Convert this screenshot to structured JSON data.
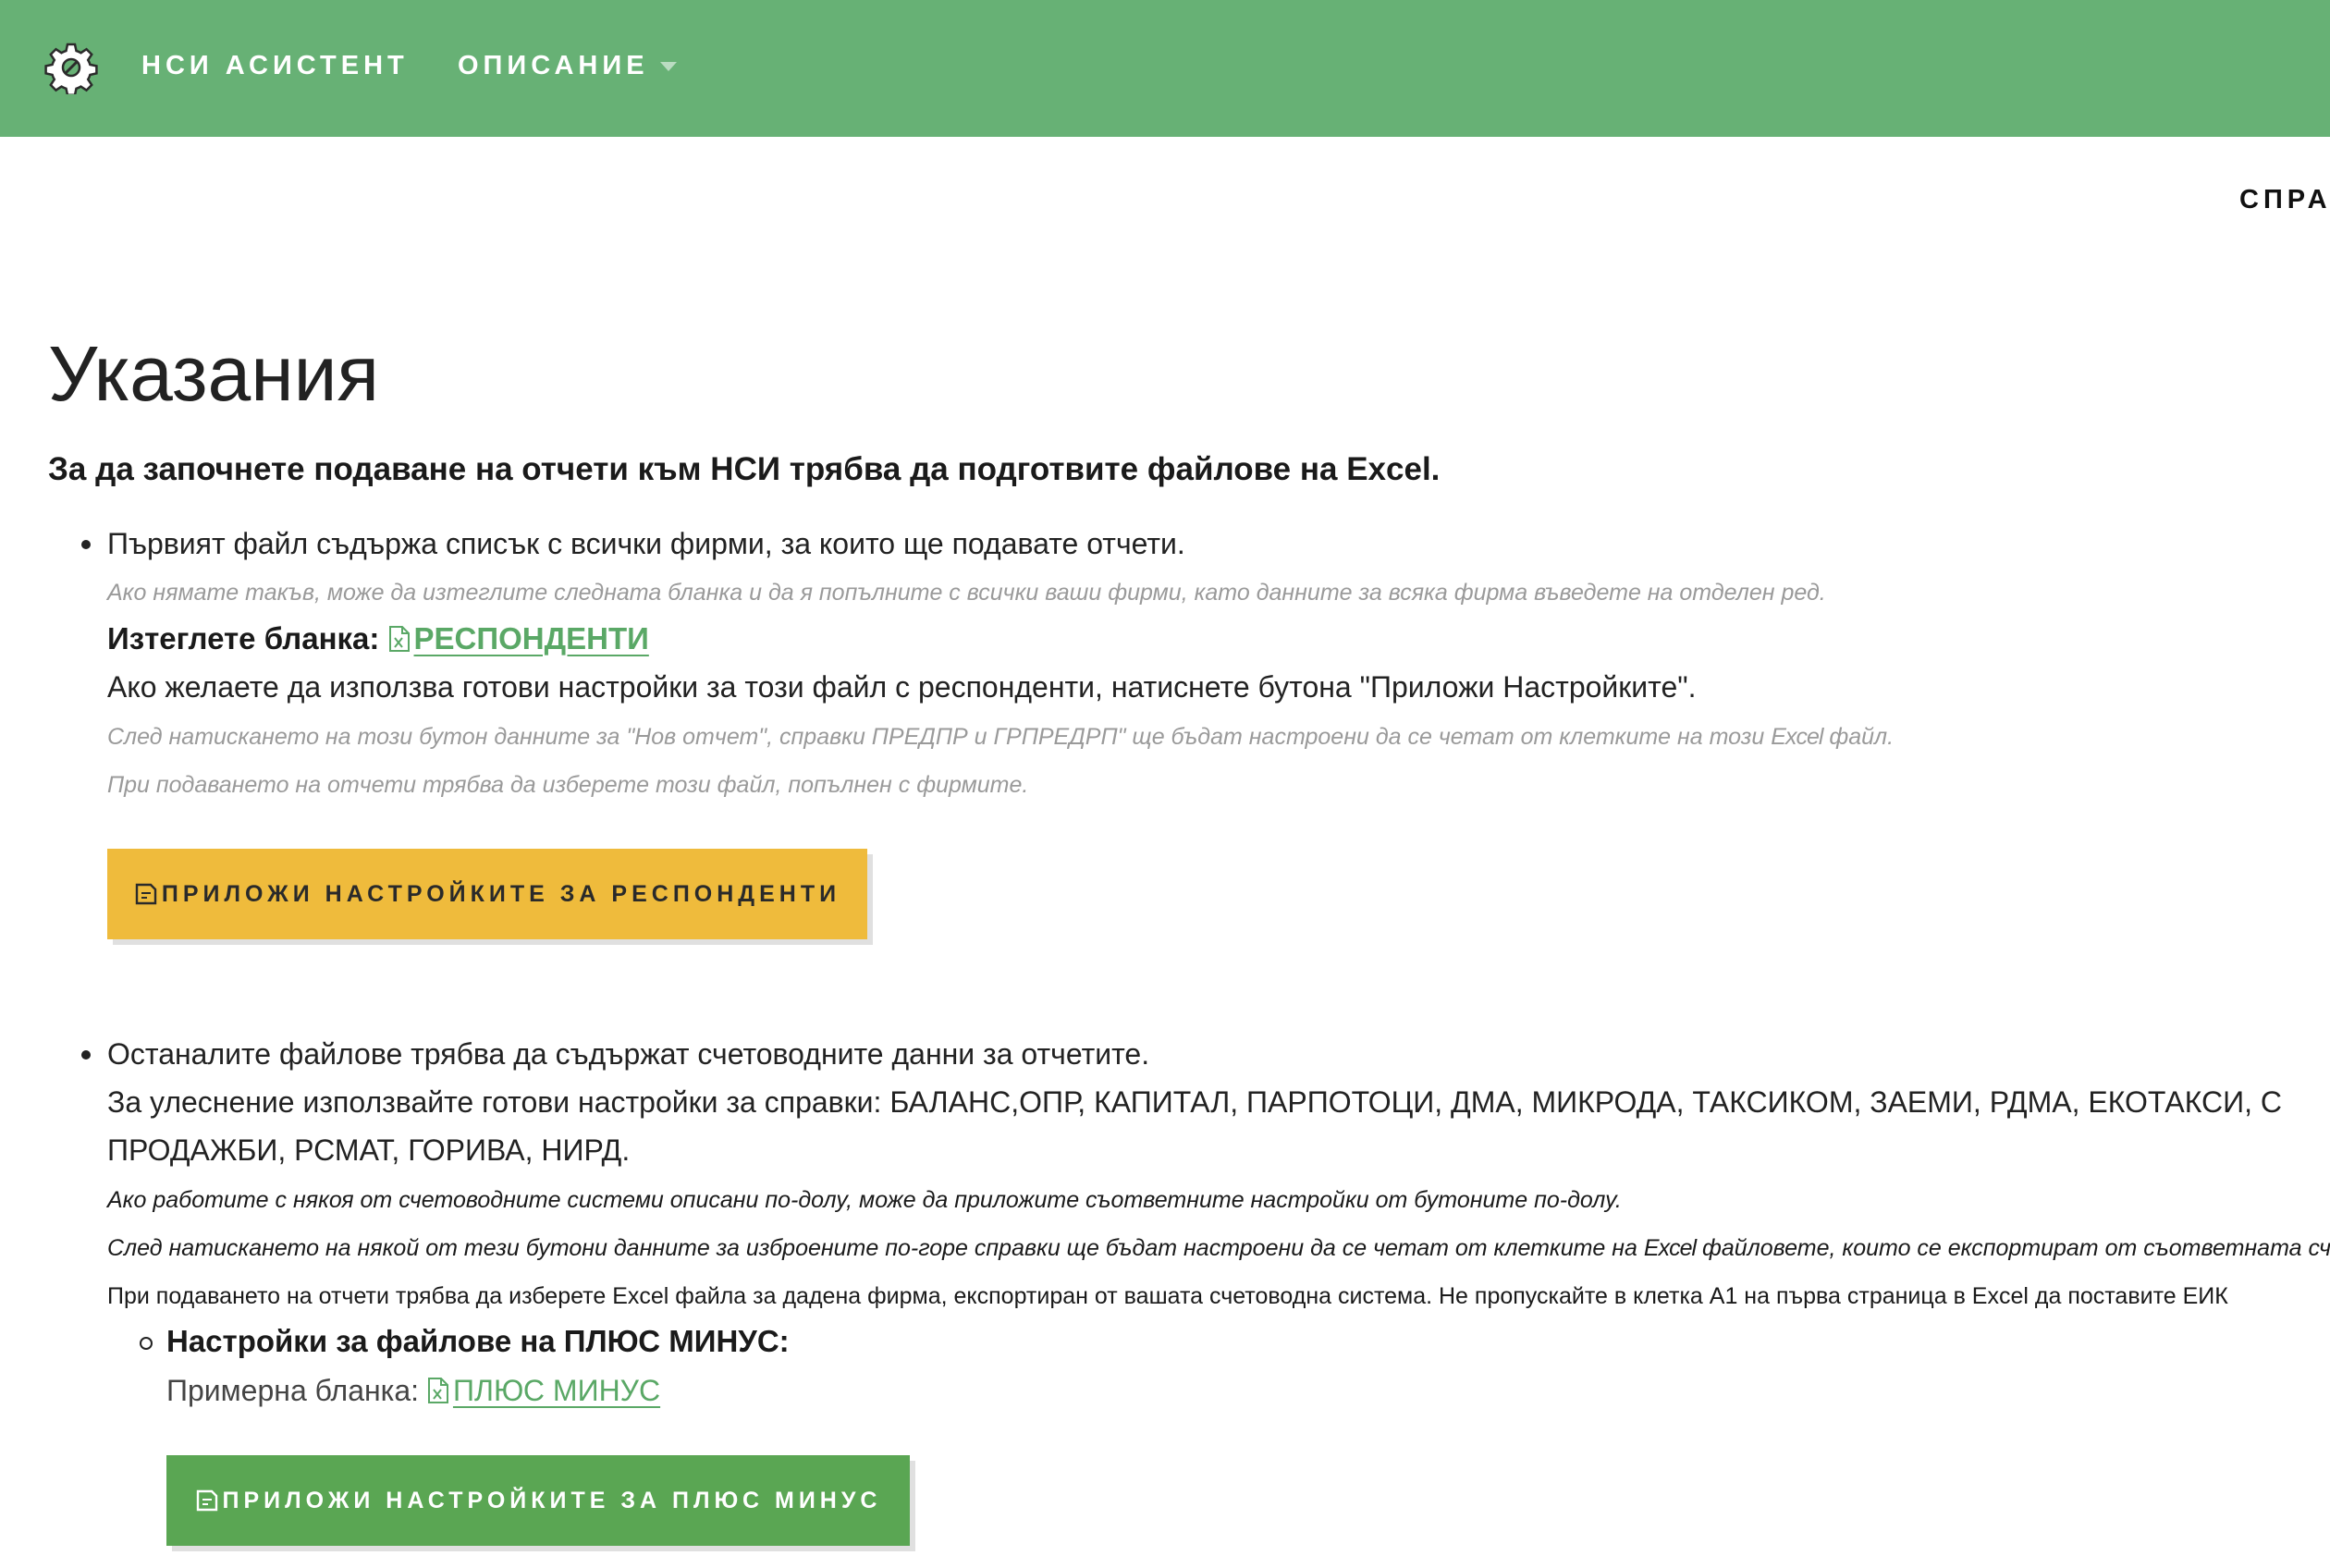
{
  "nav": {
    "brand": "НСИ АСИСТЕНТ",
    "description_menu": "ОПИСАНИЕ",
    "right_cut": "СПРА"
  },
  "page": {
    "title": "Указания",
    "lead": "За да започнете подаване на отчети към НСИ трябва да подготвите файлове на Excel."
  },
  "section1": {
    "bullet": "Първият файл съдържа списък с всички фирми, за които ще подавате отчети.",
    "note": "Ако нямате такъв, може да изтеглите следната бланка и да я попълните с всички ваши фирми, като данните за всяка фирма въведете на отделен ред.",
    "download_label": "Изтеглете бланка:",
    "download_link": "РЕСПОНДЕНТИ",
    "settings_text": "Ако желаете да използва готови настройки за този файл с респонденти, натиснете бутона \"Приложи Настройките\".",
    "note2_start": "След натискането на този бутон данните за \"Нов отчет\", справки ПРЕДПР и ГРПРЕДРП\" ще бъдат настроени да се четат от клетките на този ",
    "note2_excel": "Excel",
    "note2_end": " файл.",
    "note3": "При подаването на отчети трябва да изберете този файл, попълнен с фирмите.",
    "button": "ПРИЛОЖИ НАСТРОЙКИТЕ ЗА РЕСПОНДЕНТИ"
  },
  "section2": {
    "bullet": "Останалите файлове трябва да съдържат счетоводните данни за отчетите.",
    "reports_line1": "За улеснение използвайте готови настройки за справки: БАЛАНС,ОПР, КАПИТАЛ, ПАРПОТОЦИ, ДМА, МИКРОДА, ТАКСИКОМ, ЗАЕМИ, РДМА, ЕКОТАКСИ, С",
    "reports_line2": "ПРОДАЖБИ, РСМАТ, ГОРИВА, НИРД.",
    "note1": "Ако работите с някоя от счетоводните системи описани по-долу, може да приложите съответните настройки от бутоните по-долу.",
    "note2_start": "След натискането на някой от тези бутони данните за изброените по-горе справки ще бъдат настроени да се четат от клетките на ",
    "note2_excel": "Excel",
    "note2_end": " файловете, които се експортират от съответната счетоводн",
    "note3": "При подаването на отчети трябва да изберете Excel файла за дадена фирма, експортиран от вашата счетоводна система. Не пропускайте в клетка А1 на първа страница в Excel да поставите ЕИК",
    "sub_heading": "Настройки за файлове на ПЛЮС МИНУС:",
    "sample_label": "Примерна бланка:",
    "sample_link": "ПЛЮС МИНУС",
    "button": "ПРИЛОЖИ НАСТРОЙКИТЕ ЗА ПЛЮС МИНУС"
  },
  "colors": {
    "header": "#67b175",
    "link": "#5aa866",
    "button_yellow": "#efbb3c",
    "button_green": "#5aa653"
  }
}
